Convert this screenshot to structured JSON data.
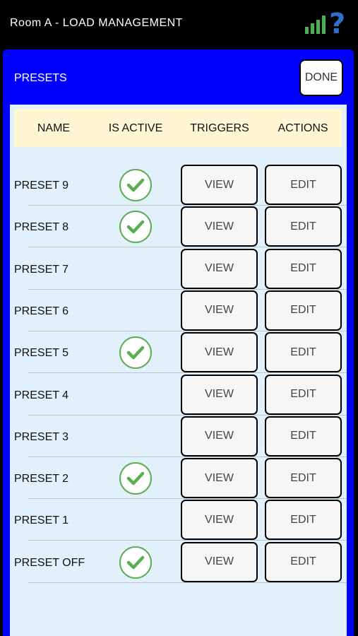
{
  "app": {
    "title": "Room A - LOAD MANAGEMENT"
  },
  "status_icons": [
    "signal-bars-icon",
    "help-question-icon"
  ],
  "panel": {
    "title": "PRESETS",
    "done_label": "DONE"
  },
  "columns": {
    "name": "NAME",
    "is_active": "IS ACTIVE",
    "triggers": "TRIGGERS",
    "actions": "ACTIONS"
  },
  "colors": {
    "panel": "#0000ff",
    "content": "#e1f0fa",
    "header_row": "#fff7d4",
    "check": "#5cad52",
    "signal": "#4caf50",
    "help": "#2f6fc9"
  },
  "presets": [
    {
      "name": "PRESET 9",
      "active": true,
      "view_label": "VIEW",
      "edit_label": "EDIT"
    },
    {
      "name": "PRESET 8",
      "active": true,
      "view_label": "VIEW",
      "edit_label": "EDIT"
    },
    {
      "name": "PRESET 7",
      "active": false,
      "view_label": "VIEW",
      "edit_label": "EDIT"
    },
    {
      "name": "PRESET 6",
      "active": false,
      "view_label": "VIEW",
      "edit_label": "EDIT"
    },
    {
      "name": "PRESET 5",
      "active": true,
      "view_label": "VIEW",
      "edit_label": "EDIT"
    },
    {
      "name": "PRESET 4",
      "active": false,
      "view_label": "VIEW",
      "edit_label": "EDIT"
    },
    {
      "name": "PRESET 3",
      "active": false,
      "view_label": "VIEW",
      "edit_label": "EDIT"
    },
    {
      "name": "PRESET 2",
      "active": true,
      "view_label": "VIEW",
      "edit_label": "EDIT"
    },
    {
      "name": "PRESET 1",
      "active": false,
      "view_label": "VIEW",
      "edit_label": "EDIT"
    },
    {
      "name": "PRESET OFF",
      "active": true,
      "view_label": "VIEW",
      "edit_label": "EDIT"
    }
  ]
}
